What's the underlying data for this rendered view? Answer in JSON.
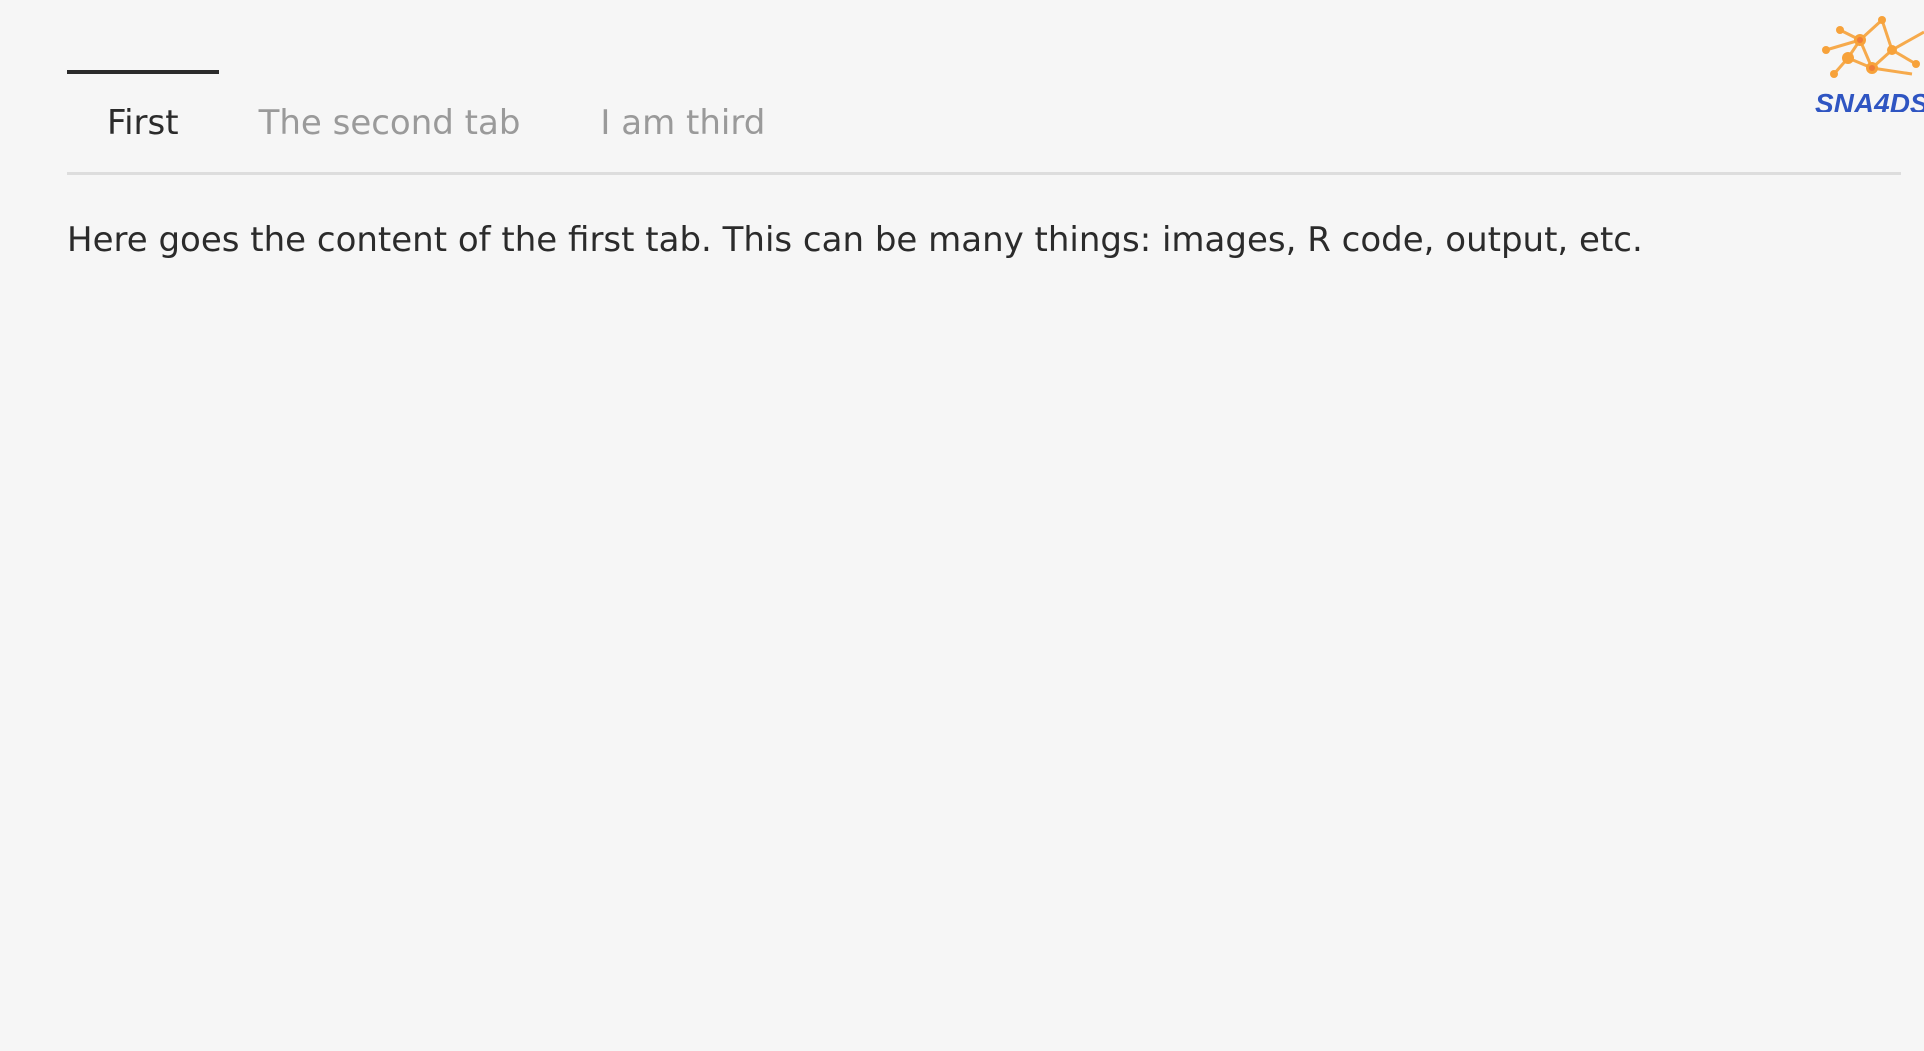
{
  "logo": {
    "text": "SNA4DS",
    "icon": "network-graph-icon",
    "node_color": "#f7a23a",
    "text_color": "#2f55c2"
  },
  "tabs": [
    {
      "label": "First",
      "active": true
    },
    {
      "label": "The second tab",
      "active": false
    },
    {
      "label": "I am third",
      "active": false
    }
  ],
  "content": {
    "text": "Here goes the content of the first tab. This can be many things: images, R code, output, etc."
  }
}
